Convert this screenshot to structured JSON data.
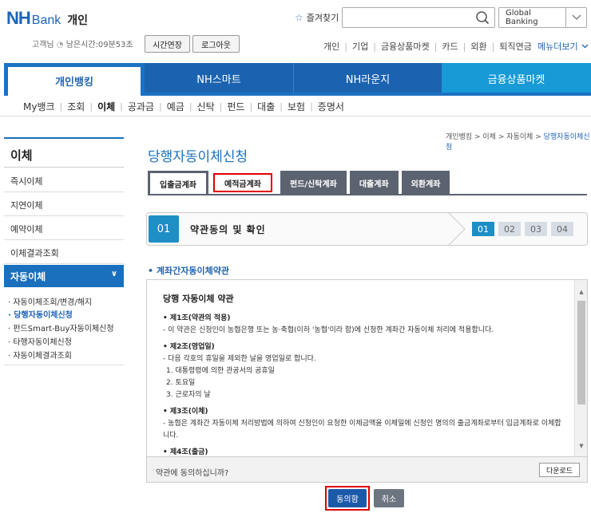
{
  "header": {
    "logo_nh": "NH",
    "logo_bank": "Bank",
    "logo_personal": "개인",
    "favorites": "즐겨찾기",
    "search_value": "",
    "global_banking": "Global Banking",
    "user_greeting": "고객님",
    "remaining_time": "남은시간:09분53초",
    "extend_button": "시간연장",
    "logout_button": "로그아웃",
    "top_links": [
      "개인",
      "기업",
      "금융상품마켓",
      "카드",
      "외환",
      "퇴직연금"
    ],
    "menu_all": "메뉴더보기"
  },
  "gnb": {
    "tabs": [
      "개인뱅킹",
      "NH스마트",
      "NH라운지",
      "금융상품마켓"
    ]
  },
  "sub_nav": {
    "items": [
      "My뱅크",
      "조회",
      "이체",
      "공과금",
      "예금",
      "신탁",
      "펀드",
      "대출",
      "보험",
      "증명서"
    ]
  },
  "lnb": {
    "title": "이체",
    "items": [
      "즉시이체",
      "지연이체",
      "예약이체",
      "이체결과조회"
    ],
    "active": "자동이체",
    "sub_items": [
      "자동이체조회/변경/해지",
      "당행자동이체신청",
      "펀드Smart-Buy자동이체신청",
      "타행자동이체신청",
      "자동이체결과조회"
    ]
  },
  "main": {
    "breadcrumb": [
      "개인뱅킹",
      "이체",
      "자동이체",
      "당행자동이체신청"
    ],
    "title": "당행자동이체신청",
    "tabs": [
      "입출금계좌",
      "예적금계좌",
      "펀드/신탁계좌",
      "대출계좌",
      "외환계좌"
    ],
    "step_number": "01",
    "step_label": "약관동의 및 확인",
    "steps": [
      "01",
      "02",
      "03",
      "04"
    ],
    "terms_heading": "계좌간자동이체약관",
    "terms": {
      "doc_title": "당행 자동이체 약관",
      "art1_title": "제1조(약관의 적용)",
      "art1_body": "이 약관은 신청인이 농협은행 또는 농·축협(이하 '농협'이라 함)에 신청한 계좌간 자동이체 처리에 적용합니다.",
      "art2_title": "제2조(영업일)",
      "art2_body": "다음 각호의 휴일을 제외한 날을 영업일로 합니다.",
      "art2_list": [
        "1. 대통령령에 의한 관공서의 공휴일",
        "2. 토요일",
        "3. 근로자의 날"
      ],
      "art3_title": "제3조(이체)",
      "art3_body": "농협은 계좌간 자동이체 처리방법에 의하여 신청인이 요청한 이체금액을 이체일에 신청인 명의의 출금계좌로부터 입금계좌로 이체합니다.",
      "art4_title": "제4조(출금)"
    },
    "agree_question": "약관에 동의하십니까?",
    "download_button": "다운로드",
    "agree_button": "동의함",
    "cancel_button": "취소"
  },
  "colors": {
    "brand_blue": "#1b63b0",
    "accent_cyan": "#179ad6",
    "highlight_red": "#e00000",
    "tab_gray": "#5c6370"
  }
}
